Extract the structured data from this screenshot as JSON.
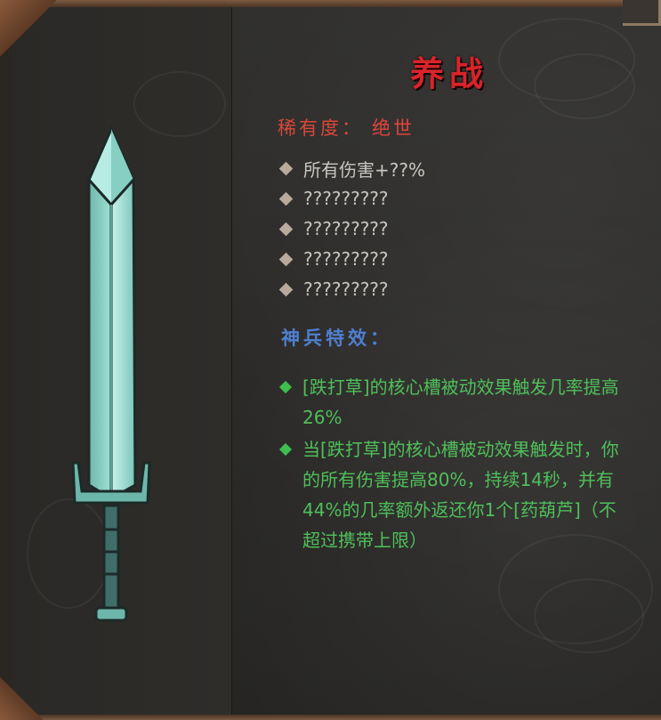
{
  "item": {
    "name": "养战",
    "rarity_label": "稀有度：",
    "rarity_value": "绝世",
    "stats": [
      "所有伤害+??%",
      "?????????",
      "?????????",
      "?????????",
      "?????????"
    ],
    "effect_title": "神兵特效：",
    "effects": [
      "[跌打草]的核心槽被动效果触发几率提高26%",
      "当[跌打草]的核心槽被动效果触发时，你的所有伤害提高80%，持续14秒，并有44%的几率额外返还你1个[药葫芦]（不超过携带上限）"
    ]
  },
  "icons": {
    "weapon": "sword-icon",
    "stat_bullet": "diamond-icon",
    "effect_bullet": "green-diamond-icon"
  },
  "colors": {
    "title": "#d8242a",
    "rarity": "#e0443c",
    "effect_title": "#4f7fd0",
    "effect_text": "#4fbf5a",
    "stat_text": "#c9c6c1"
  }
}
